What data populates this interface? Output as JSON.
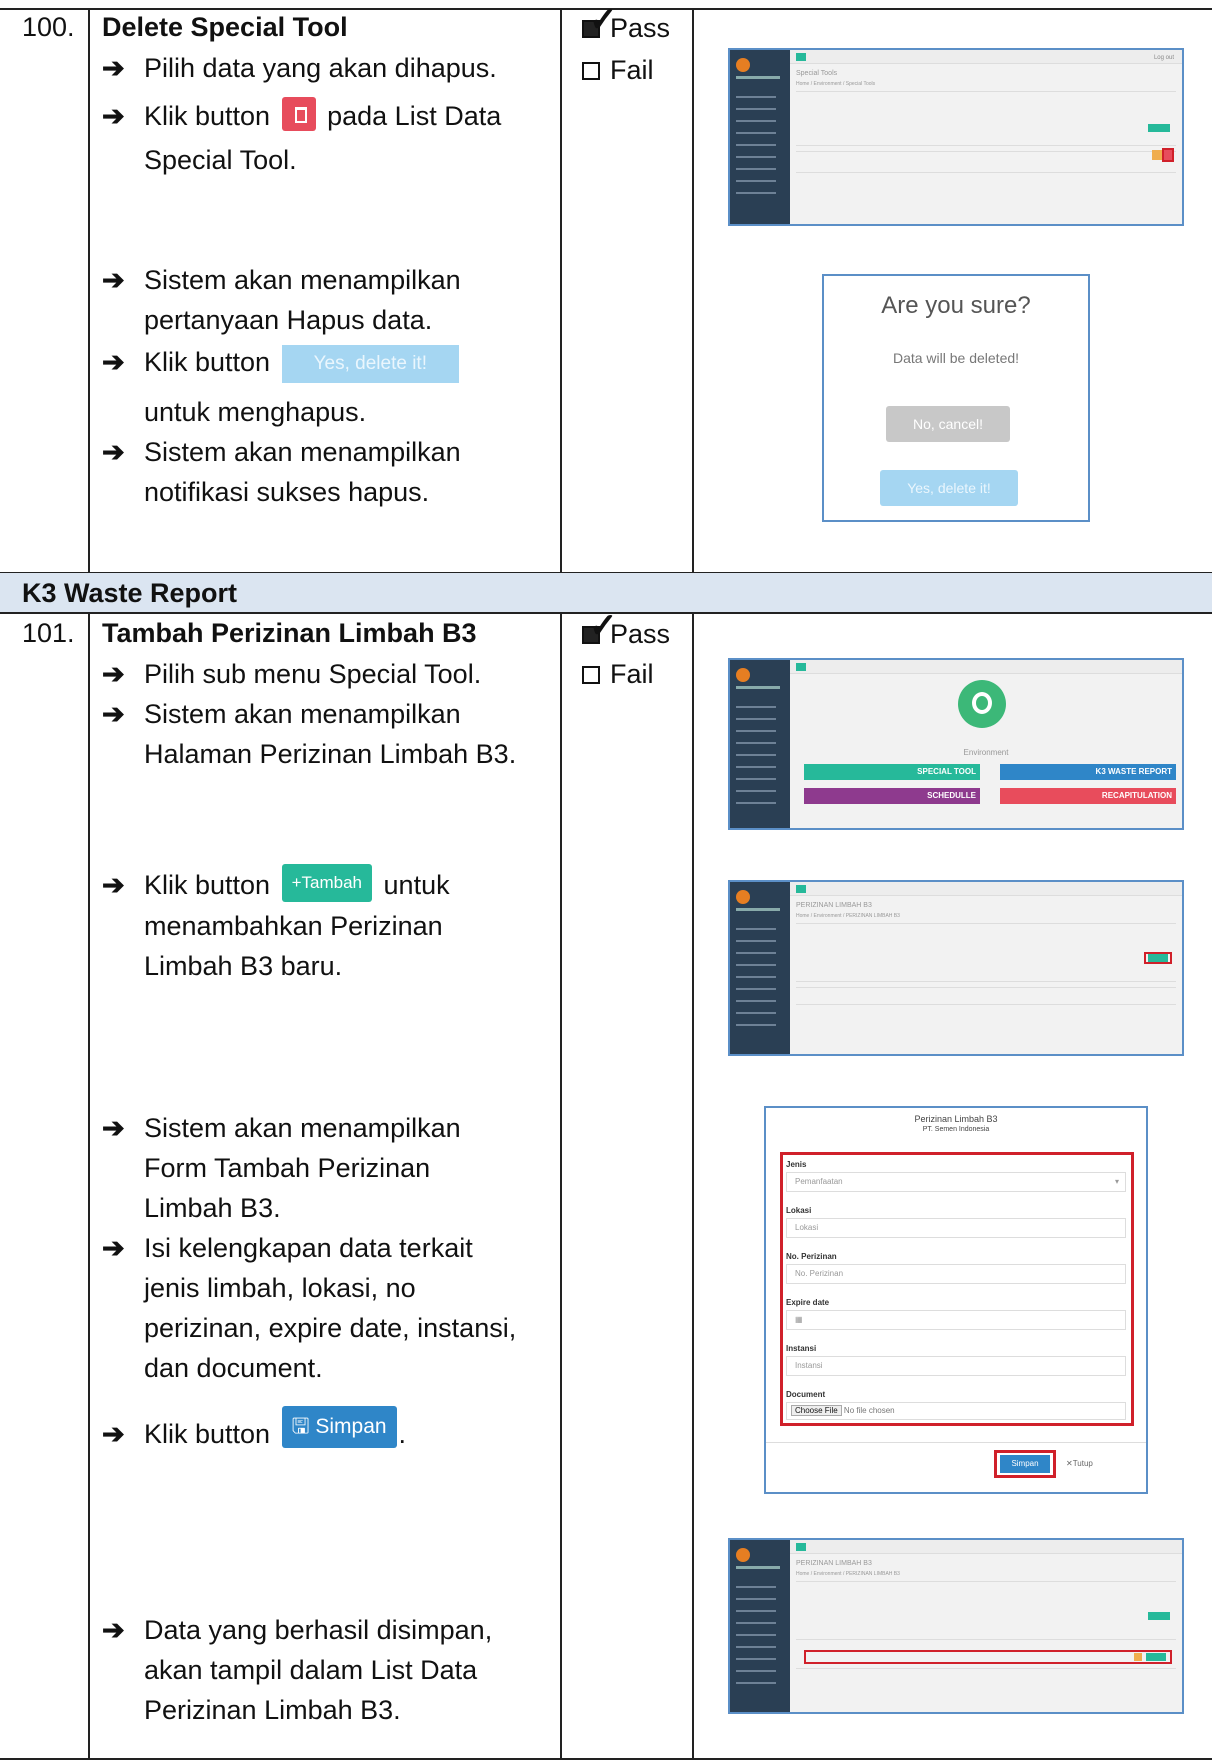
{
  "row100": {
    "number": "100.",
    "title": "Delete Special Tool",
    "steps": [
      "Pilih data yang akan dihapus.",
      "Klik button",
      "pada List Data",
      "Special Tool.",
      "Sistem akan menampilkan",
      "pertanyaan Hapus data.",
      "Klik button",
      "Yes, delete it!",
      "untuk menghapus.",
      "Sistem akan menampilkan",
      "notifikasi sukses hapus."
    ],
    "pass": "Pass",
    "fail": "Fail",
    "shot1": {
      "title": "Special Tools",
      "breadcrumb": "Home / Environment / Special Tools",
      "logout": "Log out"
    },
    "dialog": {
      "question": "Are you sure?",
      "message": "Data will be deleted!",
      "cancel": "No, cancel!",
      "confirm": "Yes, delete it!"
    }
  },
  "section": {
    "label": "K3 Waste Report"
  },
  "row101": {
    "number": "101.",
    "title": "Tambah Perizinan Limbah B3",
    "steps": {
      "s1": "Pilih sub menu Special Tool.",
      "s2a": "Sistem akan menampilkan",
      "s2b": "Halaman Perizinan Limbah B3.",
      "s3a": "Klik button",
      "s3btn": "Tambah",
      "s3b": "untuk",
      "s3c": "menambahkan Perizinan",
      "s3d": "Limbah B3 baru.",
      "s4a": "Sistem akan menampilkan",
      "s4b": "Form Tambah Perizinan",
      "s4c": "Limbah B3.",
      "s5a": "Isi kelengkapan data terkait",
      "s5b": "jenis limbah, lokasi, no",
      "s5c": "perizinan, expire date, instansi,",
      "s5d": "dan document.",
      "s6a": "Klik button",
      "s6btn": "Simpan",
      "s7a": "Data yang berhasil disimpan,",
      "s7b": "akan tampil dalam List Data",
      "s7c": "Perizinan Limbah B3."
    },
    "pass": "Pass",
    "fail": "Fail",
    "env": {
      "label": "Environment",
      "special_tool": "SPECIAL TOOL",
      "k3_waste": "K3 WASTE REPORT",
      "schedule": "SCHEDULLE",
      "recap": "RECAPITULATION"
    },
    "list": {
      "title": "PERIZINAN LIMBAH B3",
      "breadcrumb": "Home / Environment / PERIZINAN LIMBAH B3"
    },
    "form": {
      "title": "Perizinan Limbah B3",
      "subtitle": "PT. Semen Indonesia",
      "jenis_label": "Jenis",
      "jenis_value": "Pemanfaatan",
      "lokasi_label": "Lokasi",
      "lokasi_ph": "Lokasi",
      "noperizinan_label": "No. Perizinan",
      "noperizinan_ph": "No. Perizinan",
      "expire_label": "Expire date",
      "instansi_label": "Instansi",
      "instansi_ph": "Instansi",
      "document_label": "Document",
      "choose_file": "Choose File",
      "no_file": "No file chosen",
      "save": "Simpan",
      "close": "Tutup"
    }
  }
}
